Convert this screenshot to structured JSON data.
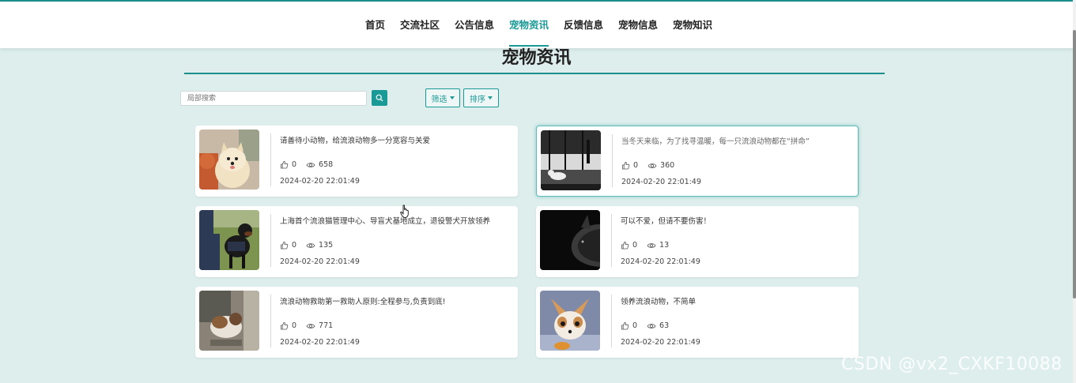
{
  "nav": {
    "items": [
      {
        "label": "首页"
      },
      {
        "label": "交流社区"
      },
      {
        "label": "公告信息"
      },
      {
        "label": "宠物资讯"
      },
      {
        "label": "反馈信息"
      },
      {
        "label": "宠物信息"
      },
      {
        "label": "宠物知识"
      }
    ],
    "active_index": 3
  },
  "page_title": "宠物资讯",
  "search": {
    "placeholder": "局部搜索",
    "value": ""
  },
  "filter_label": "筛选",
  "sort_label": "排序",
  "articles": [
    {
      "title": "请善待小动物，给流浪动物多一分宽容与关爱",
      "likes": "0",
      "views": "658",
      "date": "2024-02-20 22:01:49"
    },
    {
      "title": "当冬天来临，为了找寻温暖，每一只流浪动物都在“拼命”",
      "likes": "0",
      "views": "360",
      "date": "2024-02-20 22:01:49"
    },
    {
      "title": "上海首个流浪猫管理中心、导盲犬基地成立，退役警犬开放领养",
      "likes": "0",
      "views": "135",
      "date": "2024-02-20 22:01:49"
    },
    {
      "title": "可以不爱，但请不要伤害！",
      "likes": "0",
      "views": "13",
      "date": "2024-02-20 22:01:49"
    },
    {
      "title": "流浪动物救助第一救助人原则:全程参与,负责到底!",
      "likes": "0",
      "views": "771",
      "date": "2024-02-20 22:01:49"
    },
    {
      "title": "领养流浪动物，不简单",
      "likes": "0",
      "views": "63",
      "date": "2024-02-20 22:01:49"
    }
  ],
  "watermark": "CSDN @vx2_CXKF10088",
  "colors": {
    "accent": "#1a9a96",
    "background": "#ddeeed"
  }
}
